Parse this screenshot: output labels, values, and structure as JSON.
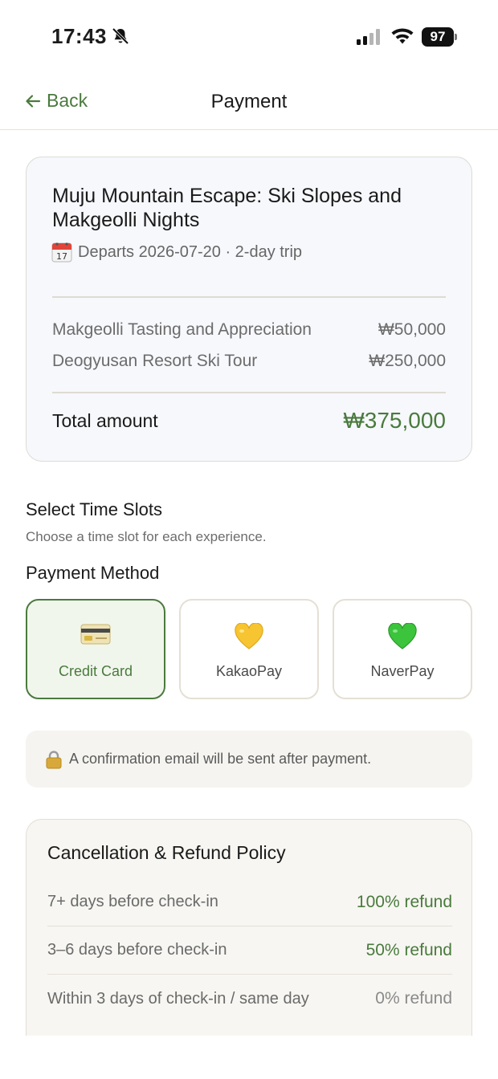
{
  "status_bar": {
    "time": "17:43",
    "battery": "97"
  },
  "nav": {
    "back_label": "Back",
    "title": "Payment"
  },
  "trip": {
    "title": "Muju Mountain Escape: Ski Slopes and Makgeolli Nights",
    "calendar_day": "17",
    "departs": "Departs 2026-07-20 · 2-day trip",
    "items": [
      {
        "name": "Makgeolli Tasting and Appreciation",
        "price": "₩50,000"
      },
      {
        "name": "Deogyusan Resort Ski Tour",
        "price": "₩250,000"
      }
    ],
    "total_label": "Total amount",
    "total_value": "₩375,000"
  },
  "time_slots": {
    "title": "Select Time Slots",
    "subtitle": "Choose a time slot for each experience."
  },
  "payment": {
    "title": "Payment Method",
    "options": [
      {
        "label": "Credit Card",
        "icon": "credit-card-icon",
        "selected": true
      },
      {
        "label": "KakaoPay",
        "icon": "yellow-heart-icon",
        "selected": false
      },
      {
        "label": "NaverPay",
        "icon": "green-heart-icon",
        "selected": false
      }
    ]
  },
  "notice": {
    "text": "A confirmation email will be sent after payment."
  },
  "policy": {
    "title": "Cancellation & Refund Policy",
    "rows": [
      {
        "condition": "7+ days before check-in",
        "refund": "100% refund"
      },
      {
        "condition": "3–6 days before check-in",
        "refund": "50% refund"
      },
      {
        "condition": "Within 3 days of check-in / same day",
        "refund": "0% refund"
      }
    ]
  },
  "colors": {
    "accent": "#4a7a3d",
    "card_bg": "#f6f8fc",
    "border": "#dcdcd4"
  }
}
